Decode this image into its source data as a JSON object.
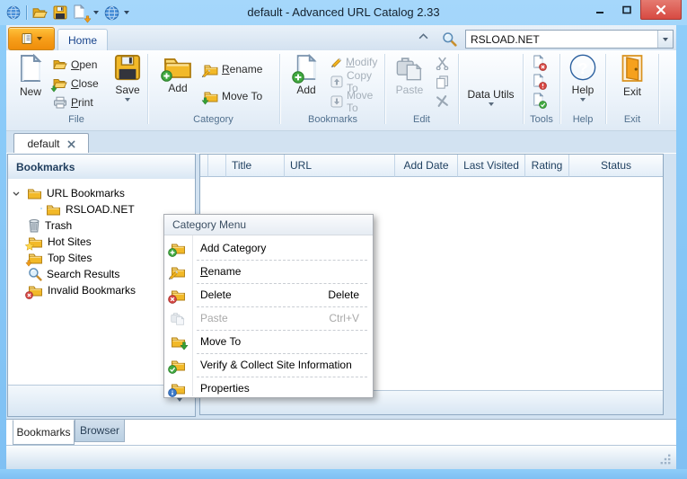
{
  "window": {
    "title": "default - Advanced URL Catalog 2.33"
  },
  "tab_bar": {
    "home": "Home",
    "search_value": "RSLOAD.NET"
  },
  "ribbon": {
    "file": {
      "caption": "File",
      "new": "New",
      "open": "Open",
      "close": "Close",
      "print": "Print",
      "save": "Save"
    },
    "category": {
      "caption": "Category",
      "add": "Add",
      "rename": "Rename",
      "move_to": "Move To"
    },
    "bookmarks": {
      "caption": "Bookmarks",
      "add": "Add",
      "modify": "Modify",
      "copy_to": "Copy To",
      "move_to": "Move To"
    },
    "edit": {
      "caption": "Edit",
      "paste": "Paste"
    },
    "data_utils": {
      "label": "Data Utils"
    },
    "tools": {
      "caption": "Tools"
    },
    "help": {
      "caption": "Help",
      "label": "Help"
    },
    "exit": {
      "caption": "Exit",
      "label": "Exit"
    }
  },
  "document_tab": {
    "label": "default"
  },
  "sidebar": {
    "header": "Bookmarks",
    "items": [
      {
        "label": "URL Bookmarks",
        "icon": "folder-icon",
        "level": 0,
        "expanded": true
      },
      {
        "label": "RSLOAD.NET",
        "icon": "folder-icon",
        "level": 1,
        "selected": true
      },
      {
        "label": "Trash",
        "icon": "trash-icon",
        "level": 0
      },
      {
        "label": "Hot Sites",
        "icon": "folder-star-icon",
        "level": 0
      },
      {
        "label": "Top Sites",
        "icon": "folder-icon",
        "level": 0
      },
      {
        "label": "Search Results",
        "icon": "magnifier-icon",
        "level": 0
      },
      {
        "label": "Invalid Bookmarks",
        "icon": "folder-error-icon",
        "level": 0
      }
    ]
  },
  "table": {
    "columns": [
      {
        "label": ""
      },
      {
        "label": ""
      },
      {
        "label": "Title"
      },
      {
        "label": "URL"
      },
      {
        "label": "Add Date"
      },
      {
        "label": "Last Visited"
      },
      {
        "label": "Rating"
      },
      {
        "label": "Status"
      }
    ],
    "rows": []
  },
  "context_menu": {
    "title": "Category Menu",
    "items": [
      {
        "label": "Add Category",
        "shortcut": "",
        "icon": "folder-plus-icon",
        "disabled": false
      },
      {
        "label": "Rename",
        "shortcut": "",
        "icon": "folder-pencil-icon",
        "disabled": false
      },
      {
        "label": "Delete",
        "shortcut": "Delete",
        "icon": "folder-delete-icon",
        "disabled": false
      },
      {
        "label": "Paste",
        "shortcut": "Ctrl+V",
        "icon": "paste-icon",
        "disabled": true
      },
      {
        "label": "Move To",
        "shortcut": "",
        "icon": "folder-move-icon",
        "disabled": false
      },
      {
        "label": "Verify & Collect Site Information",
        "shortcut": "",
        "icon": "folder-verify-icon",
        "disabled": false
      },
      {
        "label": "Properties",
        "shortcut": "",
        "icon": "folder-properties-icon",
        "disabled": false
      }
    ]
  },
  "bottom_tabs": [
    {
      "label": "Bookmarks"
    },
    {
      "label": "Browser"
    }
  ],
  "colors": {
    "titlebar": "#8ccbf7",
    "close_button": "#d74a42",
    "app_button_orange": "#f7a01b",
    "selection": "#cde7f8",
    "home_tab_text": "#15428b",
    "group_caption": "#51708e"
  },
  "icons": {
    "quick_access": [
      "app-globe-icon",
      "open-folder-icon",
      "save-icon",
      "export-icon",
      "settings-icon"
    ],
    "window_buttons": [
      "minimize-icon",
      "maximize-icon",
      "close-icon"
    ],
    "search_row": [
      "collapse-ribbon-icon",
      "search-key-icon"
    ]
  }
}
